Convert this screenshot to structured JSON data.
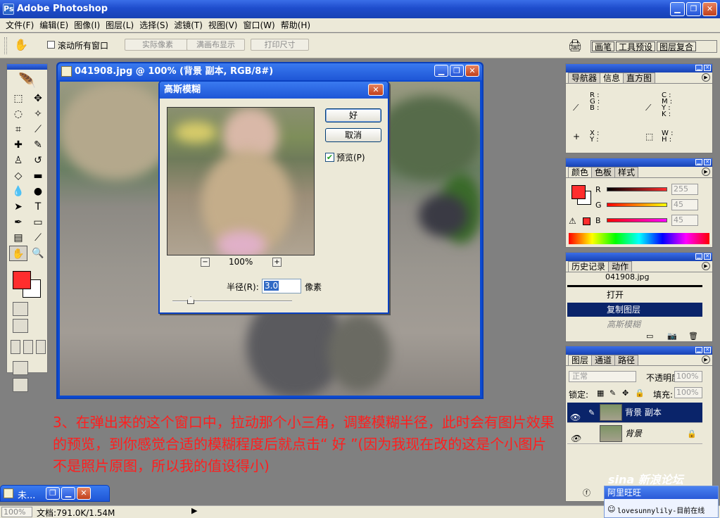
{
  "app": {
    "title": "Adobe Photoshop"
  },
  "window_buttons": {
    "minimize": "▁",
    "restore": "❐",
    "close": "✕"
  },
  "menu": [
    "文件(F)",
    "编辑(E)",
    "图像(I)",
    "图层(L)",
    "选择(S)",
    "滤镜(T)",
    "视图(V)",
    "窗口(W)",
    "帮助(H)"
  ],
  "options_bar": {
    "scroll_all_label": "滚动所有窗口",
    "actual_pixels": "实际像素",
    "fit_screen": "满画布显示",
    "print_size": "打印尺寸",
    "palette_tabs": [
      "画笔",
      "工具预设",
      "图层复合"
    ]
  },
  "document": {
    "title": "041908.jpg @ 100% (背景 副本, RGB/8#)"
  },
  "dialog": {
    "title": "高斯模糊",
    "ok": "好",
    "cancel": "取消",
    "preview_label": "预览(P)",
    "preview_checked": "✔",
    "zoom": "100%",
    "zoom_out": "−",
    "zoom_in": "+",
    "radius_label": "半径(R):",
    "radius_value": "3.0",
    "radius_unit": "像素"
  },
  "navigator": {
    "tabs": [
      "导航器",
      "信息",
      "直方图"
    ],
    "rgb": "R :\nG :\nB :",
    "cmyk": "C :\nM :\nY :\nK :",
    "xy": "X :\nY :",
    "wh": "W :\nH :"
  },
  "color": {
    "tabs": [
      "颜色",
      "色板",
      "样式"
    ],
    "r_label": "R",
    "g_label": "G",
    "b_label": "B",
    "r": "255",
    "g": "45",
    "b": "45",
    "fg_color": "#ff2d2d"
  },
  "history": {
    "tabs": [
      "历史记录",
      "动作"
    ],
    "snapshot": "041908.jpg",
    "items": [
      "打开",
      "复制图层",
      "高斯模糊"
    ]
  },
  "layers": {
    "tabs": [
      "图层",
      "通道",
      "路径"
    ],
    "blend_mode": "正常",
    "opacity_label": "不透明度:",
    "opacity": "100%",
    "lock_label": "锁定:",
    "fill_label": "填充:",
    "fill": "100%",
    "items": [
      "背景 副本",
      "背景"
    ]
  },
  "caption": "3、在弹出来的这个窗口中，拉动那个小三角，调整模糊半径，此时会有图片效果的预览，到你感觉合适的模糊程度后就点击“ 好 ”(因为我现在改的这是个小图片不是照片原图，所以我的值设得小)",
  "statusbar": {
    "zoom": "100%",
    "doc_info": "文档:791.0K/1.54M"
  },
  "minimized": {
    "label": "未..."
  },
  "tray": {
    "title": "阿里旺旺",
    "status": "lovesunnylily-目前在线"
  },
  "watermark": "sina 新浪论坛"
}
